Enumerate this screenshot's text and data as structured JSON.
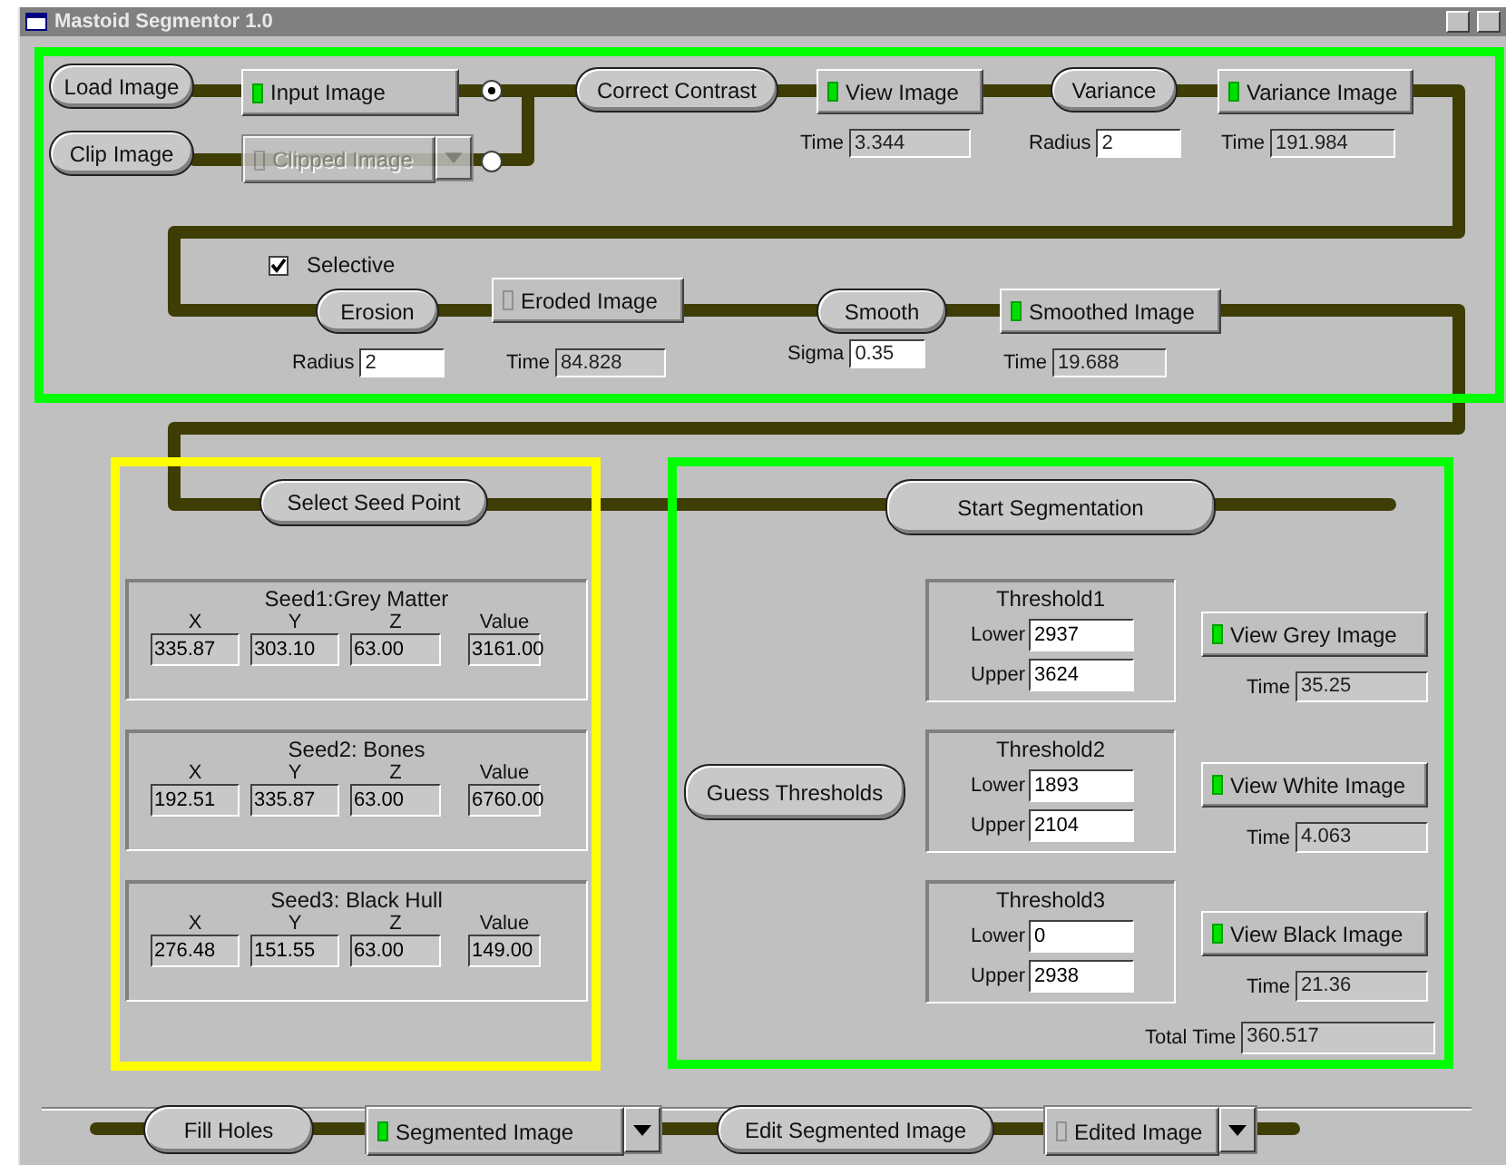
{
  "window": {
    "title": "Mastoid Segmentor 1.0"
  },
  "nodes": [
    {
      "kind": "step",
      "label": "Load Image"
    },
    {
      "kind": "output",
      "label": "Input Image",
      "ready": true
    },
    {
      "kind": "radio",
      "selected": true
    },
    {
      "kind": "step",
      "label": "Clip Image"
    },
    {
      "kind": "combo",
      "label": "Clipped Image",
      "ready": false,
      "disabled": true
    },
    {
      "kind": "radio",
      "selected": false
    },
    {
      "kind": "step",
      "label": "Correct Contrast"
    },
    {
      "kind": "output",
      "label": "View Image",
      "ready": true
    },
    {
      "kind": "readout",
      "label": "Time",
      "value": "3.344"
    },
    {
      "kind": "step",
      "label": "Variance"
    },
    {
      "kind": "param",
      "label": "Radius",
      "value": "2"
    },
    {
      "kind": "output",
      "label": "Variance Image",
      "ready": true
    },
    {
      "kind": "readout",
      "label": "Time",
      "value": "191.984"
    },
    {
      "kind": "checkbox",
      "label": "Selective",
      "checked": true
    },
    {
      "kind": "step",
      "label": "Erosion"
    },
    {
      "kind": "param",
      "label": "Radius",
      "value": "2"
    },
    {
      "kind": "output",
      "label": "Eroded Image",
      "ready": false
    },
    {
      "kind": "readout",
      "label": "Time",
      "value": "84.828"
    },
    {
      "kind": "step",
      "label": "Smooth"
    },
    {
      "kind": "param",
      "label": "Sigma",
      "value": "0.35"
    },
    {
      "kind": "output",
      "label": "Smoothed Image",
      "ready": true
    },
    {
      "kind": "readout",
      "label": "Time",
      "value": "19.688"
    },
    {
      "kind": "step",
      "label": "Select Seed Point"
    },
    {
      "kind": "step",
      "label": "Start Segmentation"
    },
    {
      "kind": "step",
      "label": "Guess Thresholds"
    },
    {
      "kind": "output",
      "label": "View Grey Image",
      "ready": true
    },
    {
      "kind": "readout",
      "label": "Time",
      "value": "35.25"
    },
    {
      "kind": "output",
      "label": "View White Image",
      "ready": true
    },
    {
      "kind": "readout",
      "label": "Time",
      "value": "4.063"
    },
    {
      "kind": "output",
      "label": "View Black Image",
      "ready": true
    },
    {
      "kind": "readout",
      "label": "Time",
      "value": "21.36"
    },
    {
      "kind": "readout",
      "label": "Total Time",
      "value": "360.517"
    },
    {
      "kind": "step",
      "label": "Fill Holes"
    },
    {
      "kind": "combo",
      "label": "Segmented Image",
      "ready": true,
      "disabled": false
    },
    {
      "kind": "step",
      "label": "Edit Segmented Image"
    },
    {
      "kind": "combo",
      "label": "Edited Image",
      "ready": false,
      "disabled": false
    }
  ],
  "seeds": [
    {
      "title": "Seed1:Grey Matter",
      "labels": [
        "X",
        "Y",
        "Z",
        "Value"
      ],
      "values": [
        "335.87",
        "303.10",
        "63.00",
        "3161.00"
      ]
    },
    {
      "title": "Seed2: Bones",
      "labels": [
        "X",
        "Y",
        "Z",
        "Value"
      ],
      "values": [
        "192.51",
        "335.87",
        "63.00",
        "6760.00"
      ]
    },
    {
      "title": "Seed3: Black Hull",
      "labels": [
        "X",
        "Y",
        "Z",
        "Value"
      ],
      "values": [
        "276.48",
        "151.55",
        "63.00",
        "149.00"
      ]
    }
  ],
  "thresholds": [
    {
      "title": "Threshold1",
      "lower_label": "Lower",
      "lower": "2937",
      "upper_label": "Upper",
      "upper": "3624"
    },
    {
      "title": "Threshold2",
      "lower_label": "Lower",
      "lower": "1893",
      "upper_label": "Upper",
      "upper": "2104"
    },
    {
      "title": "Threshold3",
      "lower_label": "Lower",
      "lower": "0",
      "upper_label": "Upper",
      "upper": "2938"
    }
  ]
}
